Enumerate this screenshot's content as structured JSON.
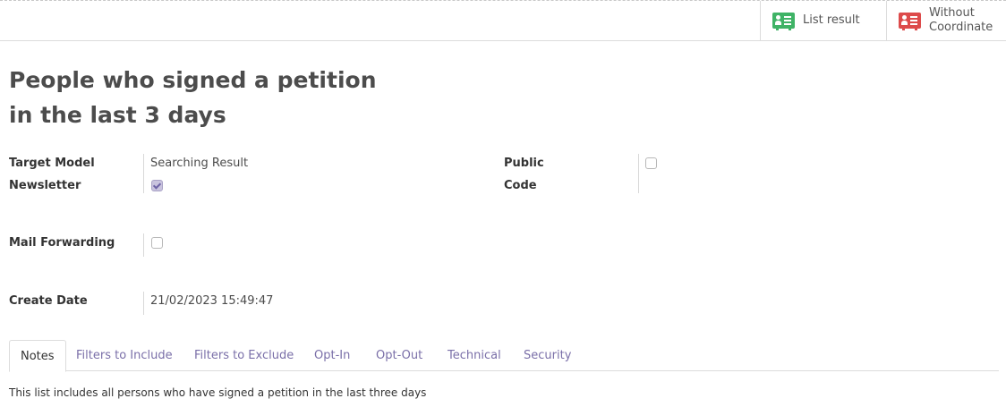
{
  "button_box": {
    "list_result": "List result",
    "without_coordinate_line1": "Without",
    "without_coordinate_line2": "Coordinate"
  },
  "record": {
    "title_line1": "People who signed a petition",
    "title_line2": "in the last 3 days"
  },
  "fields": {
    "target_model_label": "Target Model",
    "target_model_value": "Searching Result",
    "newsletter_label": "Newsletter",
    "newsletter_checked": true,
    "public_label": "Public",
    "public_checked": false,
    "code_label": "Code",
    "mail_forwarding_label": "Mail Forwarding",
    "mail_forwarding_checked": false,
    "create_date_label": "Create Date",
    "create_date_value": "21/02/2023 15:49:47"
  },
  "tabs": [
    {
      "label": "Notes",
      "active": true
    },
    {
      "label": "Filters to Include",
      "active": false
    },
    {
      "label": "Filters to Exclude",
      "active": false
    },
    {
      "label": "Opt-In",
      "active": false
    },
    {
      "label": "Opt-Out",
      "active": false
    },
    {
      "label": "Technical",
      "active": false
    },
    {
      "label": "Security",
      "active": false
    }
  ],
  "notes_text": "This list includes all persons who have signed a petition in the last three days",
  "colors": {
    "list_icon": "#3fb366",
    "coordinate_icon": "#dd4b4b",
    "tab_link": "#7a6fa8"
  }
}
